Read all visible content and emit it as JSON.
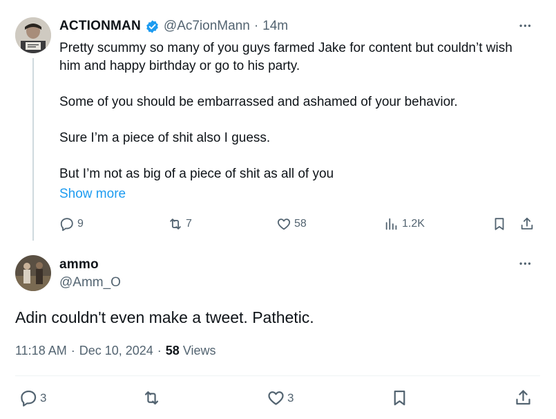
{
  "tweet": {
    "author_name": "ACTIONMAN",
    "verified": true,
    "handle": "@Ac7ionMann",
    "separator": "·",
    "time": "14m",
    "more_icon": "•••",
    "text": "Pretty scummy so many of you guys farmed Jake for content but couldn’t wish him and happy birthday or go to his party.\n\nSome of you should be embarrassed and ashamed of your behavior.\n\nSure I’m a piece of shit also I guess.\n\nBut I’m not as big of a piece of shit as all of you",
    "show_more": "Show more",
    "replies": "9",
    "reposts": "7",
    "likes": "58",
    "views": "1.2K"
  },
  "reply": {
    "author_name": "ammo",
    "handle": "@Amm_O",
    "more_icon": "•••",
    "text": "Adin couldn't even make a tweet. Pathetic.",
    "time": "11:18 AM",
    "dot1": "·",
    "date": "Dec 10, 2024",
    "dot2": "·",
    "views_count": "58",
    "views_label": "Views",
    "replies": "3",
    "likes": "3"
  },
  "colors": {
    "verified": "#1d9bf0",
    "link": "#1d9bf0",
    "muted": "#536471",
    "text": "#0f1419"
  },
  "icons": [
    "reply-icon",
    "repost-icon",
    "like-icon",
    "views-icon",
    "bookmark-icon",
    "share-icon",
    "verified-badge-icon",
    "more-icon"
  ]
}
